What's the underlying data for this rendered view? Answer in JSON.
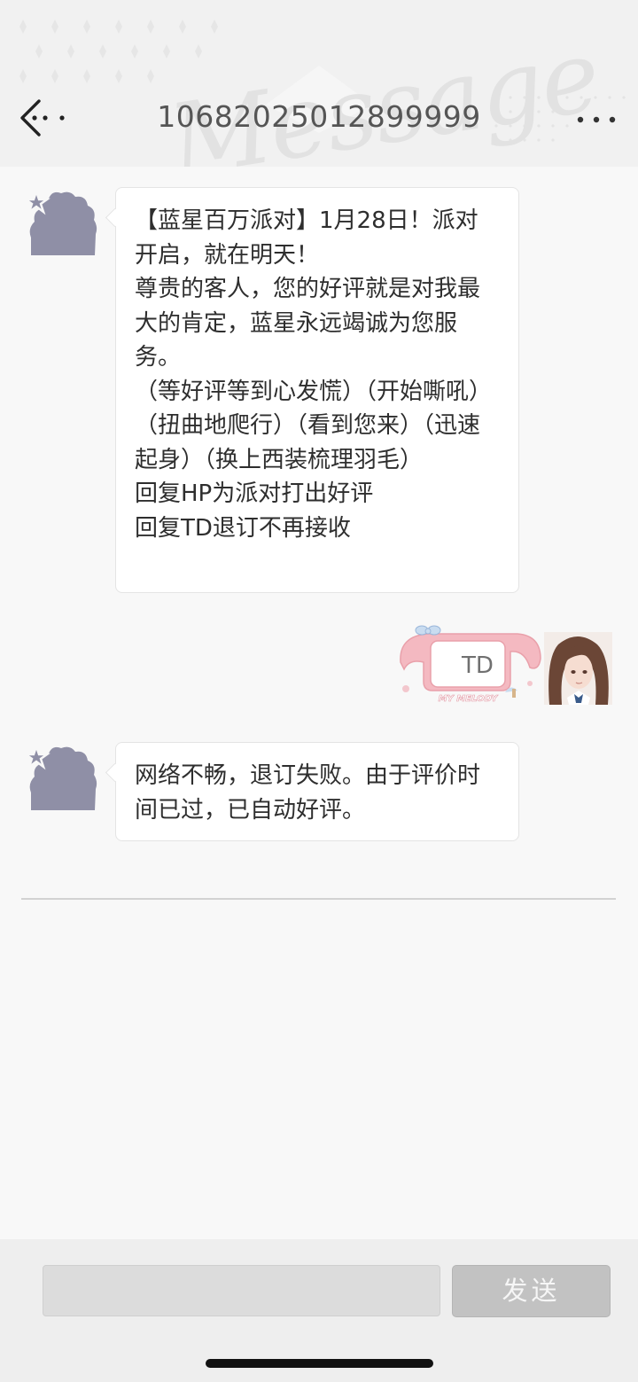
{
  "header": {
    "title": "10682025012899999",
    "watermark": "Message",
    "back_icon": "back-arrow-icon",
    "more_icon": "more-dots-icon"
  },
  "messages": [
    {
      "from": "sender",
      "avatar_icon": "star-cloud-avatar-icon",
      "text": "【蓝星百万派对】1月28日！派对开启，就在明天！\n尊贵的客人，您的好评就是对我最大的肯定，蓝星永远竭诚为您服务。\n（等好评等到心发慌）（开始嘶吼）（扭曲地爬行）（看到您来）（迅速起身）（换上西装梳理羽毛）\n回复HP为派对打出好评\n回复TD退订不再接收"
    },
    {
      "from": "me",
      "sticker_text": "TD",
      "sticker_caption": "MY MELODY"
    },
    {
      "from": "sender",
      "avatar_icon": "star-cloud-avatar-icon",
      "text": "网络不畅，退订失败。由于评价时间已过，已自动好评。"
    }
  ],
  "composer": {
    "input_value": "",
    "send_label": "发送"
  },
  "colors": {
    "avatar": "#8f8fa6",
    "bubble": "#ffffff",
    "send_button": "#c2c2c2",
    "sticker_pink": "#f4b9c1"
  }
}
